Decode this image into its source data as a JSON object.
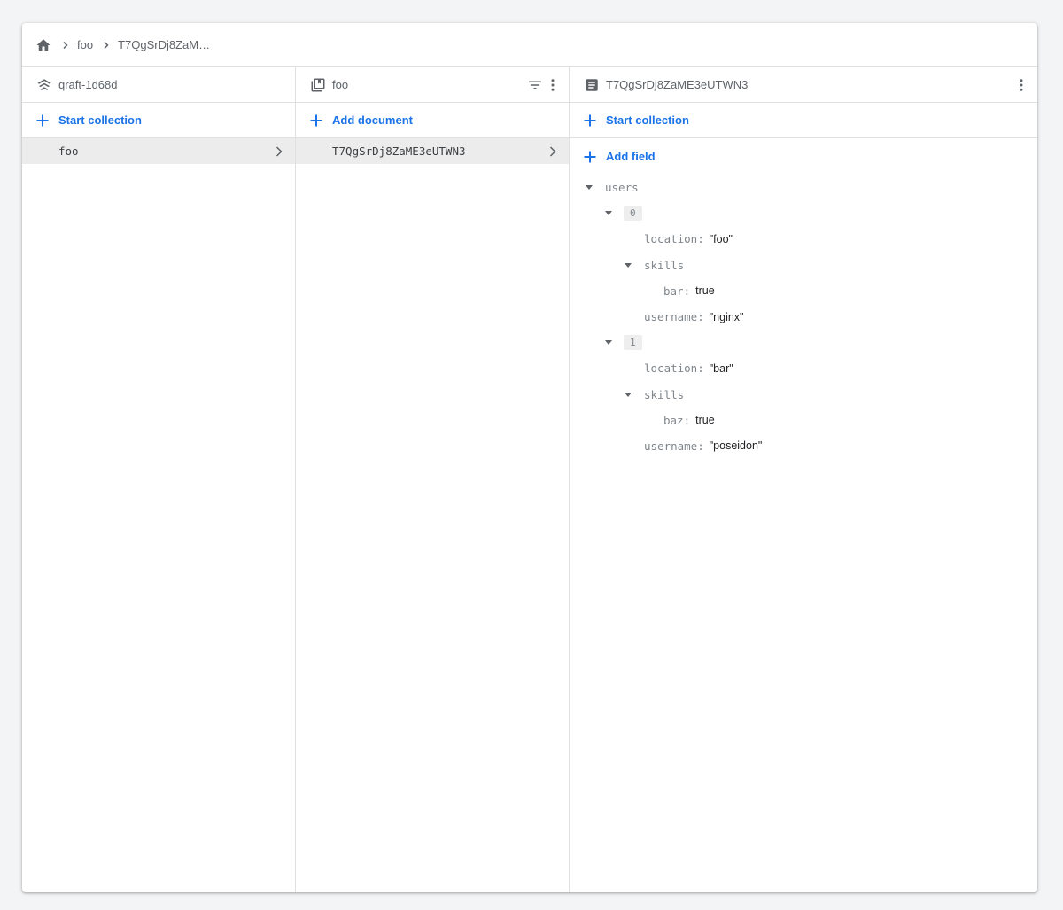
{
  "breadcrumb": {
    "items": [
      "foo",
      "T7QgSrDj8ZaM…"
    ]
  },
  "project_panel": {
    "title": "qraft-1d68d",
    "action_label": "Start collection",
    "items": [
      {
        "label": "foo",
        "selected": true
      }
    ]
  },
  "collection_panel": {
    "title": "foo",
    "action_label": "Add document",
    "items": [
      {
        "label": "T7QgSrDj8ZaME3eUTWN3",
        "selected": true
      }
    ]
  },
  "document_panel": {
    "title": "T7QgSrDj8ZaME3eUTWN3",
    "start_collection_label": "Start collection",
    "add_field_label": "Add field",
    "fields": {
      "users_key": "users",
      "item0": {
        "index": "0",
        "location_key": "location:",
        "location_val": "\"foo\"",
        "skills_key": "skills",
        "skill_key": "bar:",
        "skill_val": "true",
        "username_key": "username:",
        "username_val": "\"nginx\""
      },
      "item1": {
        "index": "1",
        "location_key": "location:",
        "location_val": "\"bar\"",
        "skills_key": "skills",
        "skill_key": "baz:",
        "skill_val": "true",
        "username_key": "username:",
        "username_val": "\"poseidon\""
      }
    }
  },
  "colors": {
    "accent": "#1a73e8",
    "icon": "#5f6368",
    "selected_bg": "#ececec"
  },
  "icons": [
    "home-icon",
    "chevron-right-icon",
    "project-icon",
    "collection-icon",
    "filter-icon",
    "more-vert-icon",
    "document-icon",
    "add-icon",
    "arrow-drop-down-icon"
  ]
}
